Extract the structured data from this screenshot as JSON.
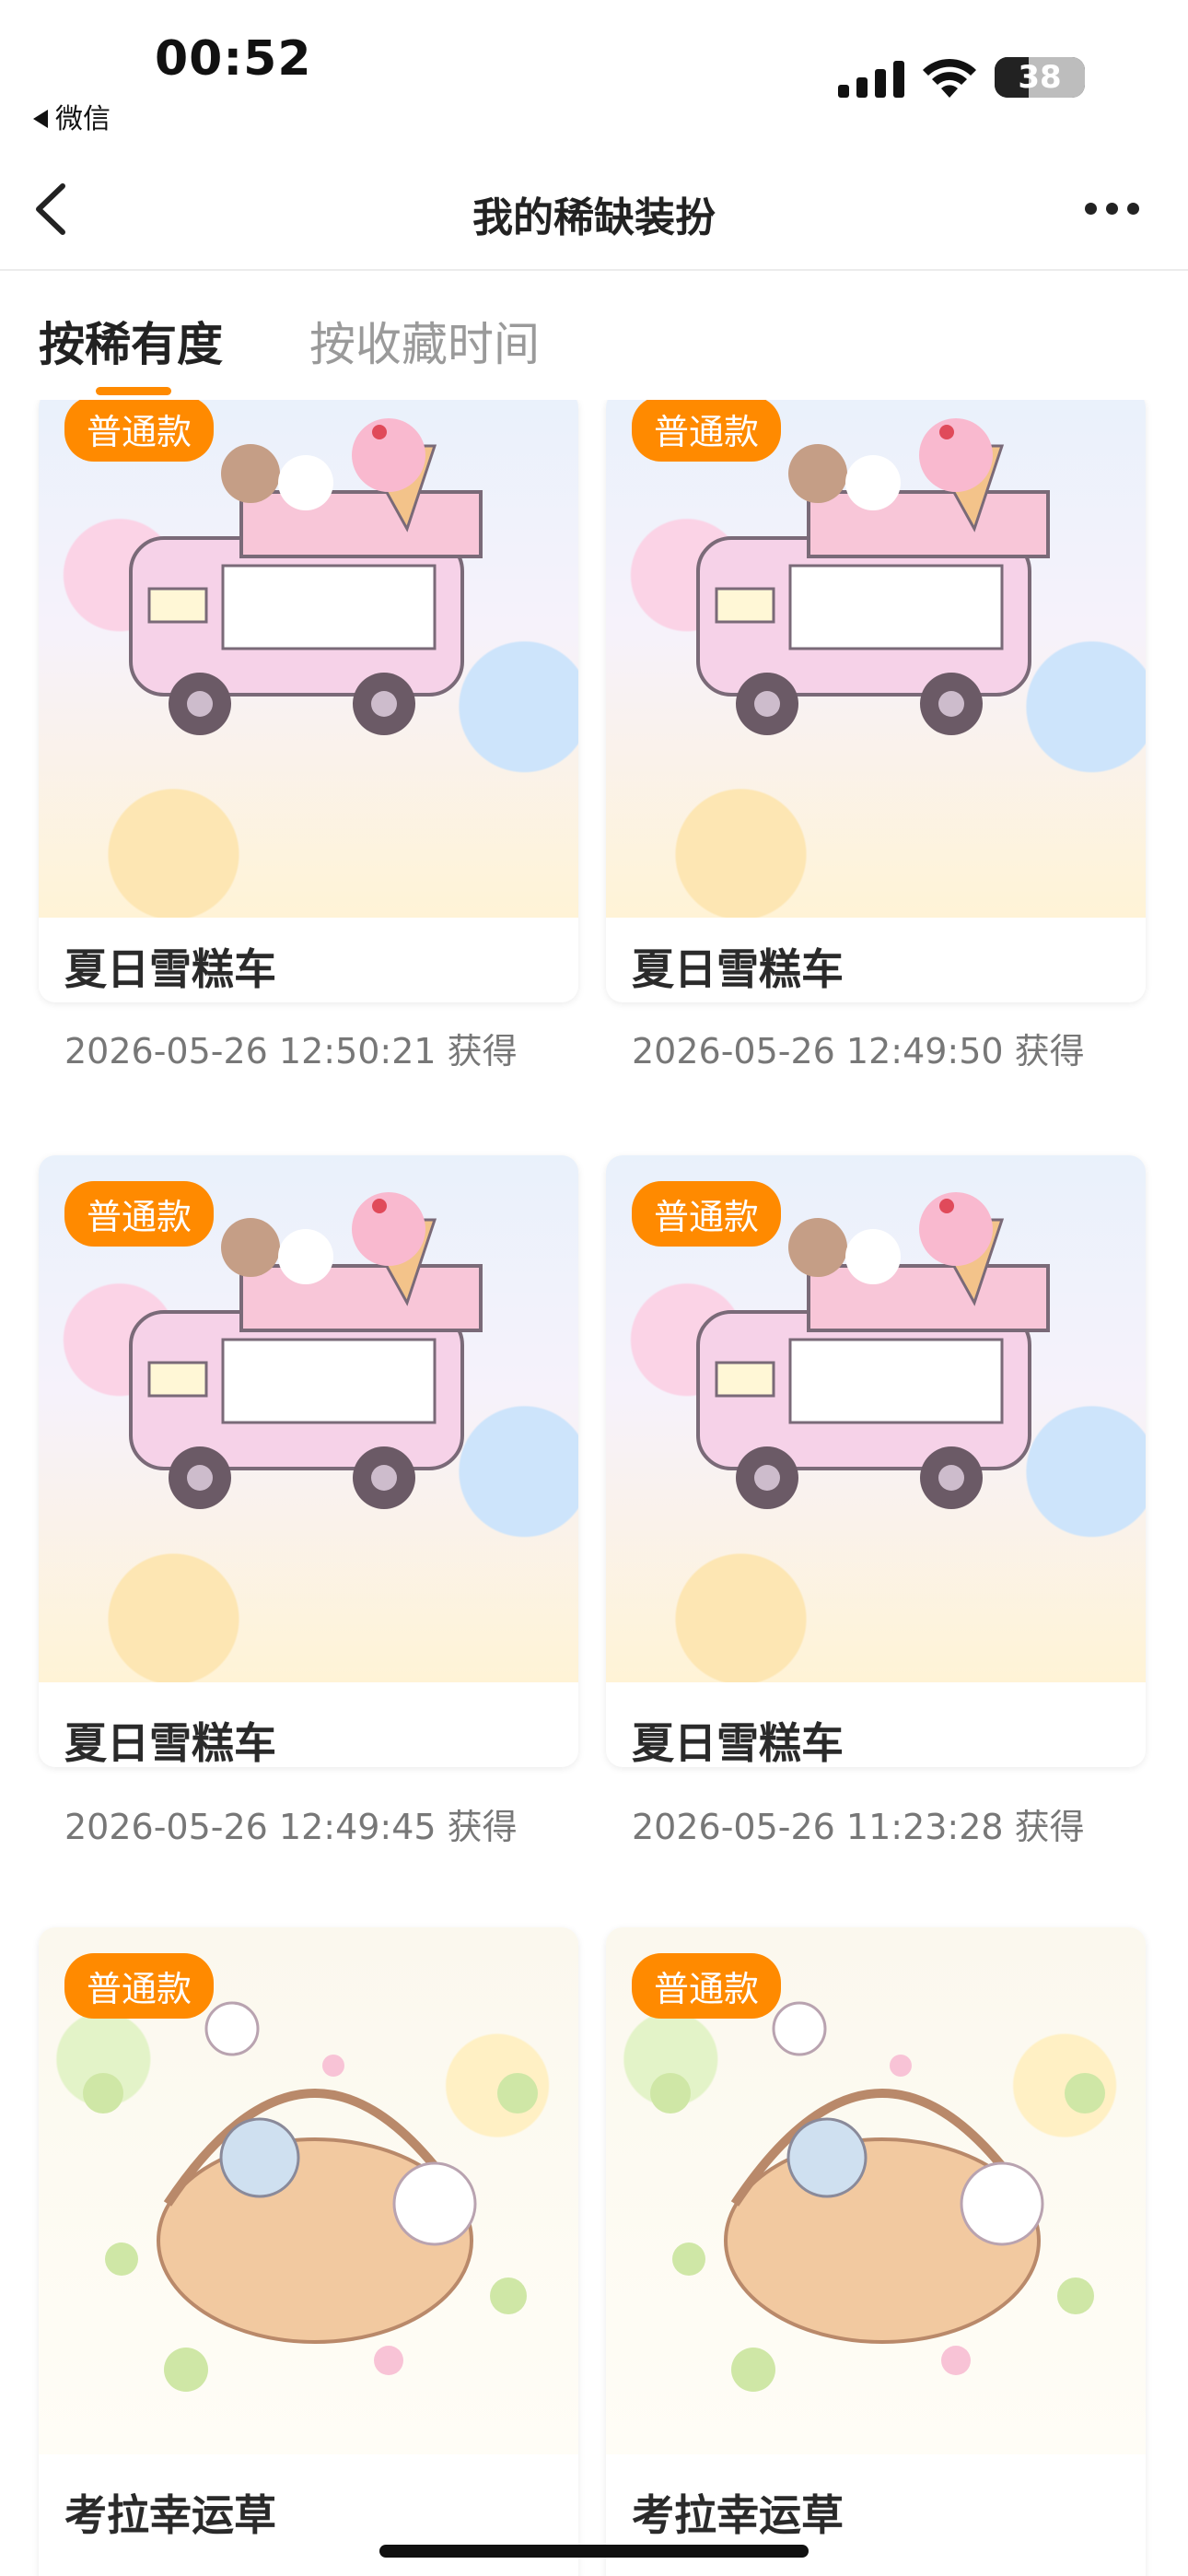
{
  "status_bar": {
    "time": "00:52",
    "back_app": "微信",
    "battery": "38",
    "battery_level": 0.38
  },
  "nav": {
    "title": "我的稀缺装扮"
  },
  "tabs": [
    {
      "label": "按稀有度",
      "active": true
    },
    {
      "label": "按收藏时间",
      "active": false
    }
  ],
  "colors": {
    "accent": "#ff8a00"
  },
  "cards": [
    {
      "badge": "普通款",
      "name": "夏日雪糕车",
      "date": "2026-05-26 12:50:21 获得",
      "art": "ice-cream-truck"
    },
    {
      "badge": "普通款",
      "name": "夏日雪糕车",
      "date": "2026-05-26 12:49:50 获得",
      "art": "ice-cream-truck"
    },
    {
      "badge": "普通款",
      "name": "夏日雪糕车",
      "date": "2026-05-26 12:49:45 获得",
      "art": "ice-cream-truck"
    },
    {
      "badge": "普通款",
      "name": "夏日雪糕车",
      "date": "2026-05-26 11:23:28 获得",
      "art": "ice-cream-truck"
    },
    {
      "badge": "普通款",
      "name": "考拉幸运草",
      "art": "koala-clover-basket"
    },
    {
      "badge": "普通款",
      "name": "考拉幸运草",
      "art": "koala-clover-basket"
    }
  ]
}
